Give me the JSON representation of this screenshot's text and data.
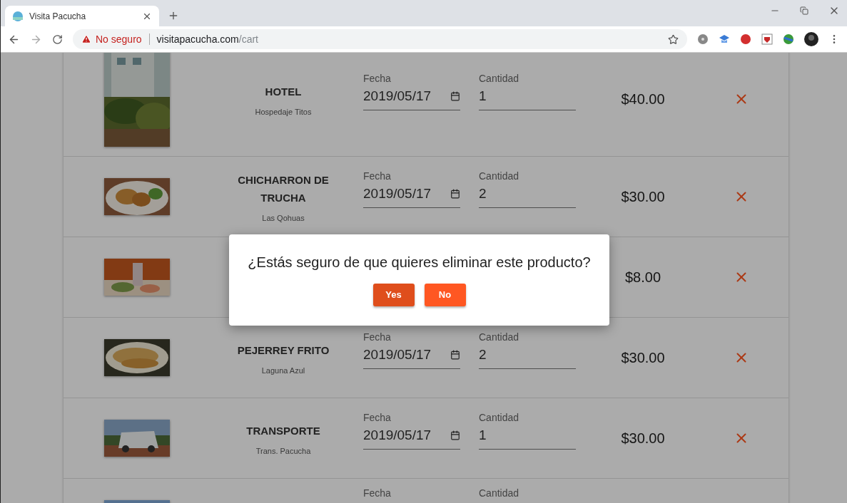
{
  "browser": {
    "tab": {
      "title": "Visita Pacucha",
      "selected": true
    },
    "address": {
      "warning": "No seguro",
      "host": "visitapacucha.com",
      "path": "/cart"
    }
  },
  "cart": {
    "rows": [
      {
        "name": "HOTEL",
        "place": "Hospedaje Titos",
        "date_label": "Fecha",
        "date": "2019/05/17",
        "qty_label": "Cantidad",
        "qty": "1",
        "price": "$40.00"
      },
      {
        "name": "CHICHARRON DE TRUCHA",
        "place": "Las Qohuas",
        "date_label": "Fecha",
        "date": "2019/05/17",
        "qty_label": "Cantidad",
        "qty": "2",
        "price": "$30.00"
      },
      {
        "price": "$8.00"
      },
      {
        "name": "PEJERREY FRITO",
        "place": "Laguna Azul",
        "date_label": "Fecha",
        "date": "2019/05/17",
        "qty_label": "Cantidad",
        "qty": "2",
        "price": "$30.00"
      },
      {
        "name": "TRANSPORTE",
        "place": "Trans. Pacucha",
        "date_label": "Fecha",
        "date": "2019/05/17",
        "qty_label": "Cantidad",
        "qty": "1",
        "price": "$30.00"
      },
      {
        "date_label": "Fecha",
        "qty_label": "Cantidad"
      }
    ]
  },
  "dialog": {
    "message": "¿Estás seguro de que quieres eliminar este producto?",
    "buttons": [
      {
        "label": "Yes",
        "focused": true
      },
      {
        "label": "No",
        "focused": false
      }
    ]
  }
}
